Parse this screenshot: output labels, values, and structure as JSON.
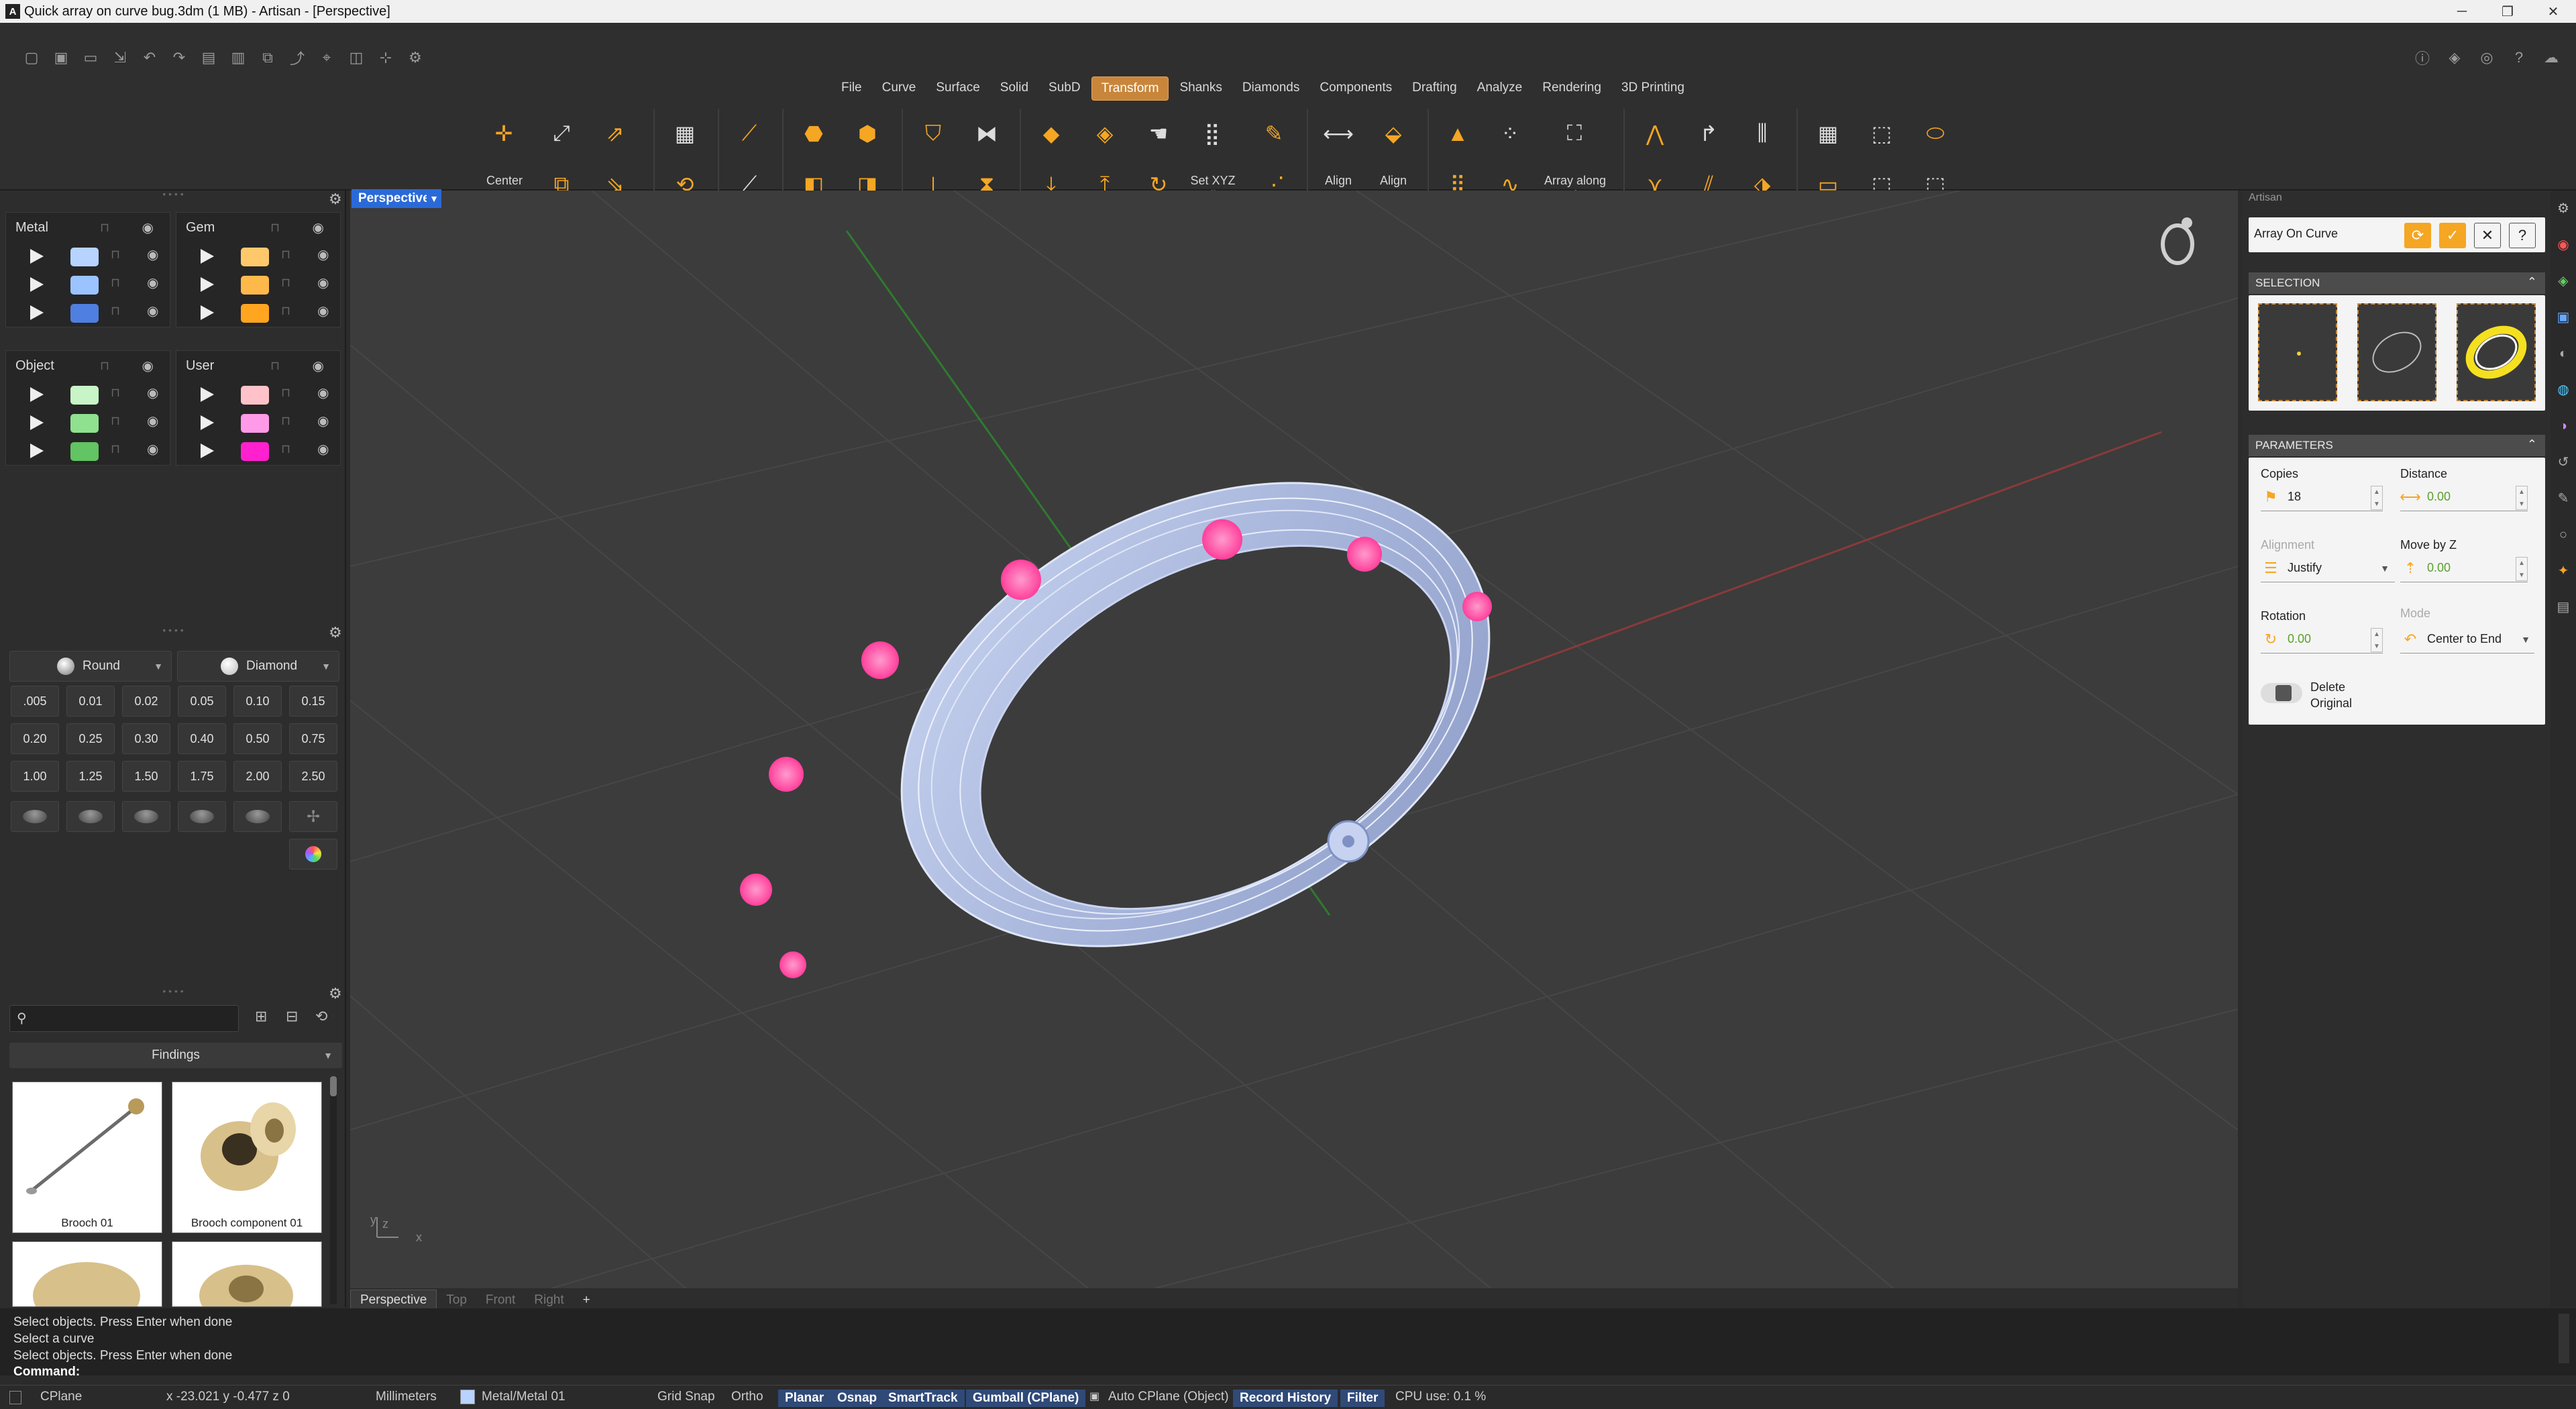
{
  "window": {
    "title": "Quick array on curve bug.3dm (1 MB) - Artisan - [Perspective]",
    "app_icon": "A",
    "buttons": [
      "─",
      "❐",
      "✕"
    ]
  },
  "menu": {
    "tabs": [
      "File",
      "Curve",
      "Surface",
      "Solid",
      "SubD",
      "Transform",
      "Shanks",
      "Diamonds",
      "Components",
      "Drafting",
      "Analyze",
      "Rendering",
      "3D Printing"
    ],
    "active": "Transform"
  },
  "ribbon": {
    "center_label": "Center",
    "setxyz_label": "Set XYZ\nCoordinates",
    "align_label": "Align",
    "aligngems_label": "Align\nGems",
    "arraysurf_label": "Array along\nSurface"
  },
  "layers": {
    "metal": {
      "title": "Metal",
      "colors": [
        "#b7d3ff",
        "#9bc3ff",
        "#4f7fe0"
      ]
    },
    "gem": {
      "title": "Gem",
      "colors": [
        "#ffc96b",
        "#ffb94a",
        "#ffa51f"
      ]
    },
    "object": {
      "title": "Object",
      "colors": [
        "#c8f5c8",
        "#8fe08f",
        "#62c462"
      ]
    },
    "user": {
      "title": "User",
      "colors": [
        "#ffc2c8",
        "#ff9ae8",
        "#ff20d0"
      ]
    }
  },
  "gems": {
    "shape": "Round",
    "material": "Diamond",
    "sizes": [
      ".005",
      "0.01",
      "0.02",
      "0.05",
      "0.10",
      "0.15",
      "0.20",
      "0.25",
      "0.30",
      "0.40",
      "0.50",
      "0.75",
      "1.00",
      "1.25",
      "1.50",
      "1.75",
      "2.00",
      "2.50"
    ]
  },
  "library": {
    "search_placeholder": "",
    "category": "Findings",
    "items": [
      "Brooch 01",
      "Brooch component 01"
    ]
  },
  "viewport": {
    "active_name": "Perspective",
    "tabs": [
      "Perspective",
      "Top",
      "Front",
      "Right"
    ],
    "add_tab": "+",
    "axis_y": "y",
    "axis_z": "z",
    "axis_x": "x"
  },
  "panel": {
    "header": "Artisan",
    "command_title": "Array On Curve",
    "selection_header": "SELECTION",
    "parameters_header": "PARAMETERS",
    "copies_label": "Copies",
    "copies_value": "18",
    "distance_label": "Distance",
    "distance_value": "0.00",
    "alignment_label": "Alignment",
    "alignment_value": "Justify",
    "movez_label": "Move by Z",
    "movez_value": "0.00",
    "rotation_label": "Rotation",
    "rotation_value": "0.00",
    "mode_label": "Mode",
    "mode_value": "Center to End",
    "delete_original_label": "Delete\nOriginal",
    "delete_original_on": false
  },
  "command": {
    "history": [
      "Select objects. Press Enter when done",
      "Select a curve",
      "Select objects. Press Enter when done"
    ],
    "prompt": "Command:"
  },
  "status": {
    "cplane": "CPlane",
    "coords": "x -23.021   y -0.477   z 0",
    "units": "Millimeters",
    "layer": "Metal/Metal 01",
    "layer_color": "#b7d3ff",
    "grid_snap": "Grid Snap",
    "ortho": "Ortho",
    "planar": "Planar",
    "osnap": "Osnap",
    "smarttrack": "SmartTrack",
    "gumball": "Gumball (CPlane)",
    "autocplane": "Auto CPlane (Object)",
    "record_history": "Record History",
    "filter": "Filter",
    "cpu": "CPU use: 0.1 %"
  },
  "colors": {
    "accent": "#c9863a",
    "viewport_tab": "#2a6ad8",
    "flower": "#ff4fa3",
    "ring": "#b8c8ec"
  }
}
